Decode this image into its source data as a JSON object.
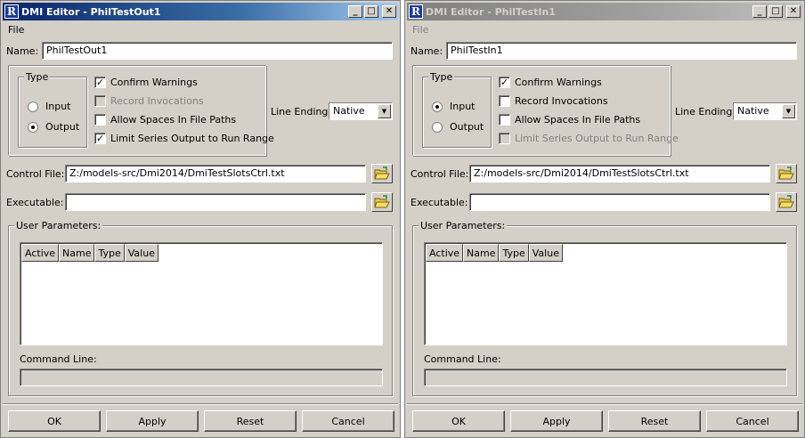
{
  "windows": [
    {
      "title": "DMI Editor - PhilTestOut1",
      "menu": [
        "File"
      ],
      "name_label": "Name:",
      "name_value": "PhilTestOut1",
      "type_legend": "Type",
      "radios": [
        {
          "label": "Input",
          "selected": false
        },
        {
          "label": "Output",
          "selected": true
        }
      ],
      "checkboxes": [
        {
          "label": "Confirm Warnings",
          "checked": true,
          "disabled": false
        },
        {
          "label": "Record Invocations",
          "checked": false,
          "disabled": true
        },
        {
          "label": "Allow Spaces In File Paths",
          "checked": false,
          "disabled": false
        },
        {
          "label": "Limit Series Output to Run Range",
          "checked": true,
          "disabled": false
        }
      ],
      "line_ending_label": "Line Ending:",
      "line_ending_value": "Native",
      "control_file_label": "Control File:",
      "control_file_value": "Z:/models-src/Dmi2014/DmiTestSlotsCtrl.txt",
      "executable_label": "Executable:",
      "executable_value": "",
      "user_params_legend": "User Parameters:",
      "table_columns": [
        "Active",
        "Name",
        "Type",
        "Value"
      ],
      "command_line_label": "Command Line:",
      "buttons": [
        "OK",
        "Apply",
        "Reset",
        "Cancel"
      ]
    },
    {
      "title": "DMI Editor - PhilTestIn1",
      "menu": [
        "File"
      ],
      "name_label": "Name:",
      "name_value": "PhilTestIn1",
      "type_legend": "Type",
      "radios": [
        {
          "label": "Input",
          "selected": true
        },
        {
          "label": "Output",
          "selected": false
        }
      ],
      "checkboxes": [
        {
          "label": "Confirm Warnings",
          "checked": true,
          "disabled": false
        },
        {
          "label": "Record Invocations",
          "checked": false,
          "disabled": false
        },
        {
          "label": "Allow Spaces In File Paths",
          "checked": false,
          "disabled": false
        },
        {
          "label": "Limit Series Output to Run Range",
          "checked": false,
          "disabled": true
        }
      ],
      "line_ending_label": "Line Ending:",
      "line_ending_value": "Native",
      "control_file_label": "Control File:",
      "control_file_value": "Z:/models-src/Dmi2014/DmiTestSlotsCtrl.txt",
      "executable_label": "Executable:",
      "executable_value": "",
      "user_params_legend": "User Parameters:",
      "table_columns": [
        "Active",
        "Name",
        "Type",
        "Value"
      ],
      "command_line_label": "Command Line:",
      "buttons": [
        "OK",
        "Apply",
        "Reset",
        "Cancel"
      ]
    }
  ],
  "colors": {
    "window_bg": "#d4d0c8",
    "active_title": "#0a246a",
    "inactive_title": "#808080"
  },
  "icons": [
    "dmi-app-icon",
    "minimize-icon",
    "maximize-icon",
    "close-icon",
    "open-folder-icon",
    "dropdown-arrow-icon"
  ]
}
